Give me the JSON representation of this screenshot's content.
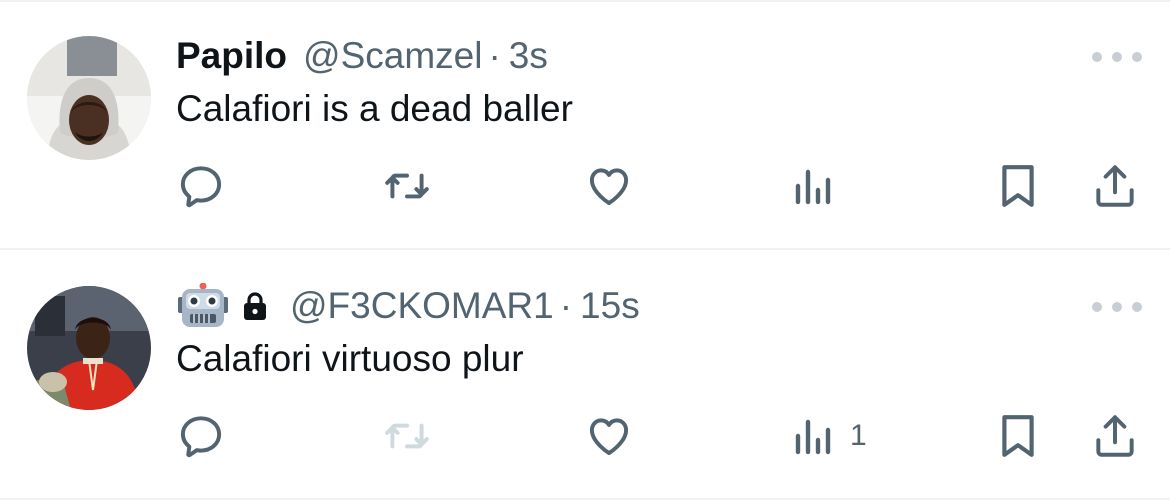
{
  "colors": {
    "text_primary": "#0f1419",
    "text_secondary": "#536471",
    "icon": "#536471",
    "icon_disabled": "#cfd9de",
    "divider": "#eff3f4"
  },
  "tweets": [
    {
      "display_name": "Papilo",
      "handle": "@Scamzel",
      "separator": "·",
      "time": "3s",
      "text": "Calafiori is a dead baller",
      "badges": [],
      "actions": {
        "reply_icon": "reply-icon",
        "retweet_icon": "retweet-icon",
        "retweet_enabled": true,
        "like_icon": "heart-icon",
        "views_icon": "views-icon",
        "views_count": "",
        "bookmark_icon": "bookmark-icon",
        "share_icon": "share-icon"
      }
    },
    {
      "display_name": "",
      "handle": "@F3CKOMAR1",
      "separator": "·",
      "time": "15s",
      "text": "Calafiori virtuoso plur",
      "badges": [
        "robot-emoji-icon",
        "lock-icon"
      ],
      "actions": {
        "reply_icon": "reply-icon",
        "retweet_icon": "retweet-icon",
        "retweet_enabled": false,
        "like_icon": "heart-icon",
        "views_icon": "views-icon",
        "views_count": "1",
        "bookmark_icon": "bookmark-icon",
        "share_icon": "share-icon"
      }
    }
  ]
}
